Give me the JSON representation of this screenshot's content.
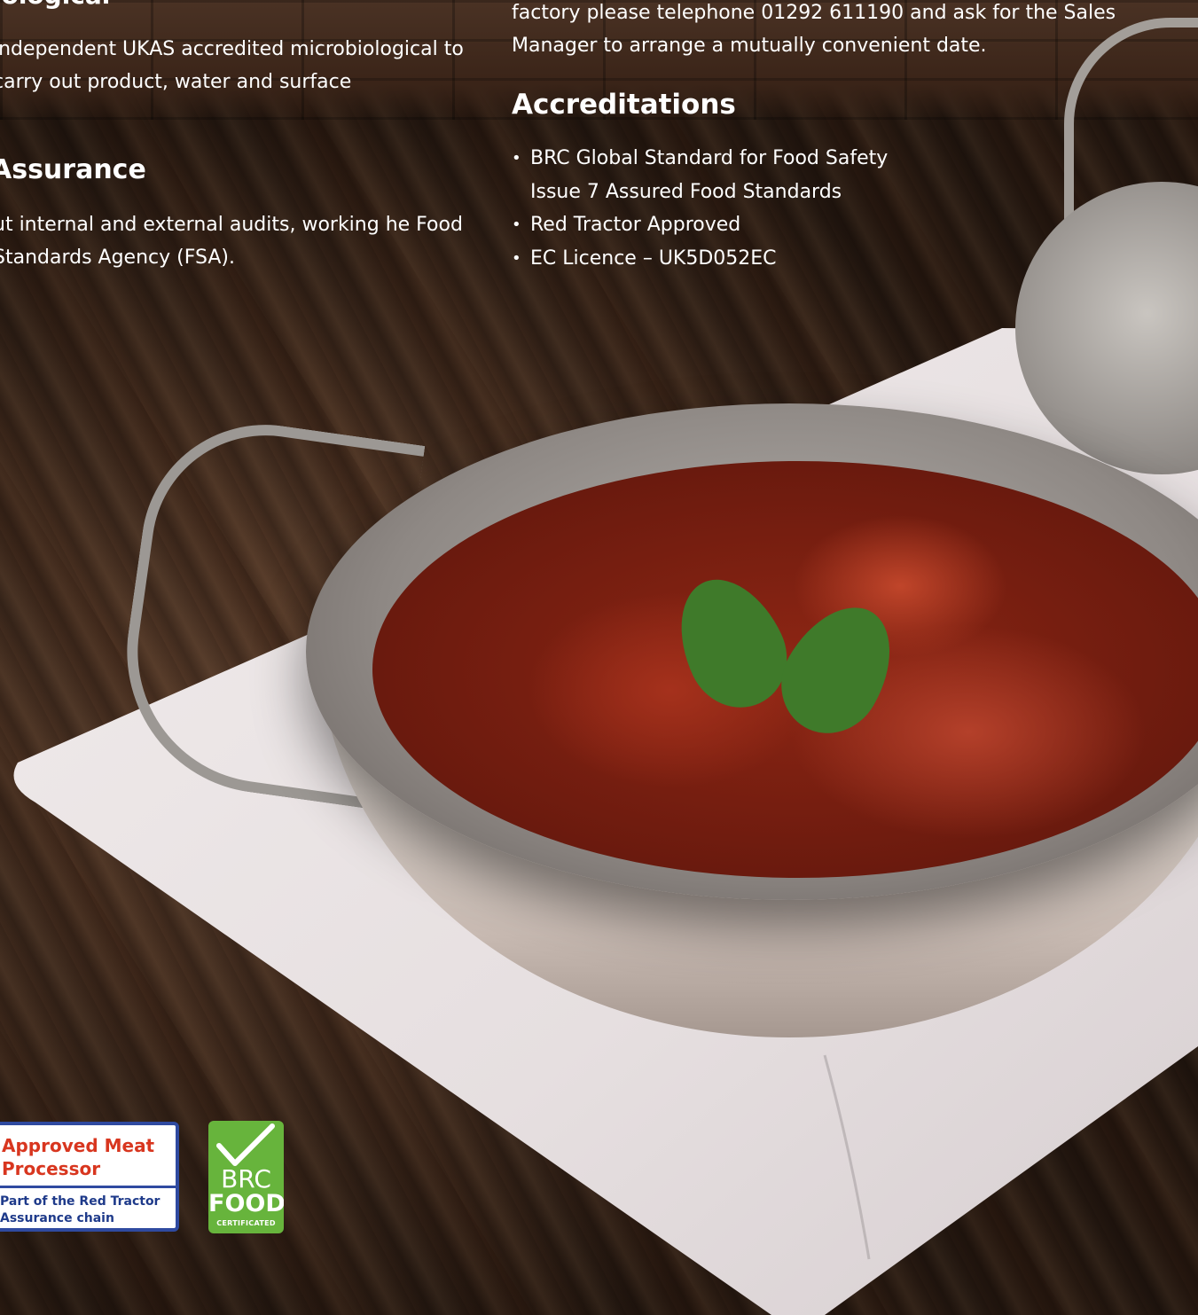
{
  "left_column": {
    "heading_cut": "iological",
    "paragraph_1": "independent UKAS accredited microbiological to carry out product, water and surface",
    "heading_2": "Assurance",
    "paragraph_2": "ut internal and external audits, working he Food Standards Agency (FSA)."
  },
  "right_column": {
    "intro": "factory please telephone 01292 611190 and ask for the Sales Manager to arrange a mutually convenient date.",
    "accreditations_heading": "Accreditations",
    "bullets": [
      {
        "line1": "BRC Global Standard for Food Safety",
        "line2": "Issue 7 Assured Food Standards"
      },
      {
        "line1": "Red Tractor Approved"
      },
      {
        "line1": "EC Licence – UK5D052EC"
      }
    ]
  },
  "logos": {
    "red_tractor": {
      "title": "Approved Meat Processor",
      "subtitle": "Part of the Red Tractor Assurance chain"
    },
    "brc": {
      "line1": "BRC",
      "line2": "FOOD",
      "line3": "CERTIFICATED"
    }
  },
  "colors": {
    "text": "#ffffff",
    "red_tractor_red": "#d8361f",
    "red_tractor_blue": "#2f4aa0",
    "brc_green": "#67b43c"
  }
}
